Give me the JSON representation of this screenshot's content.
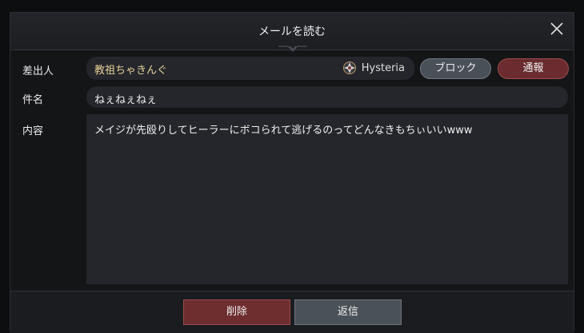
{
  "dialog": {
    "title": "メールを読む",
    "close_icon": "close-icon"
  },
  "sender": {
    "label": "差出人",
    "name": "教祖ちゃきんぐ",
    "guild_icon": "guild-emblem-icon",
    "guild": "Hysteria",
    "block_label": "ブロック",
    "report_label": "通報"
  },
  "subject": {
    "label": "件名",
    "value": "ねぇねぇねぇ"
  },
  "content": {
    "label": "内容",
    "value": "メイジが先殴りしてヒーラーにボコられて逃げるのってどんなきもちぃいいwww"
  },
  "footer": {
    "delete_label": "削除",
    "reply_label": "返信"
  },
  "colors": {
    "sender_name": "#e8d39a",
    "report": "#6a2c2e",
    "delete": "#6e2d2f",
    "neutral_button": "#4b5158"
  }
}
